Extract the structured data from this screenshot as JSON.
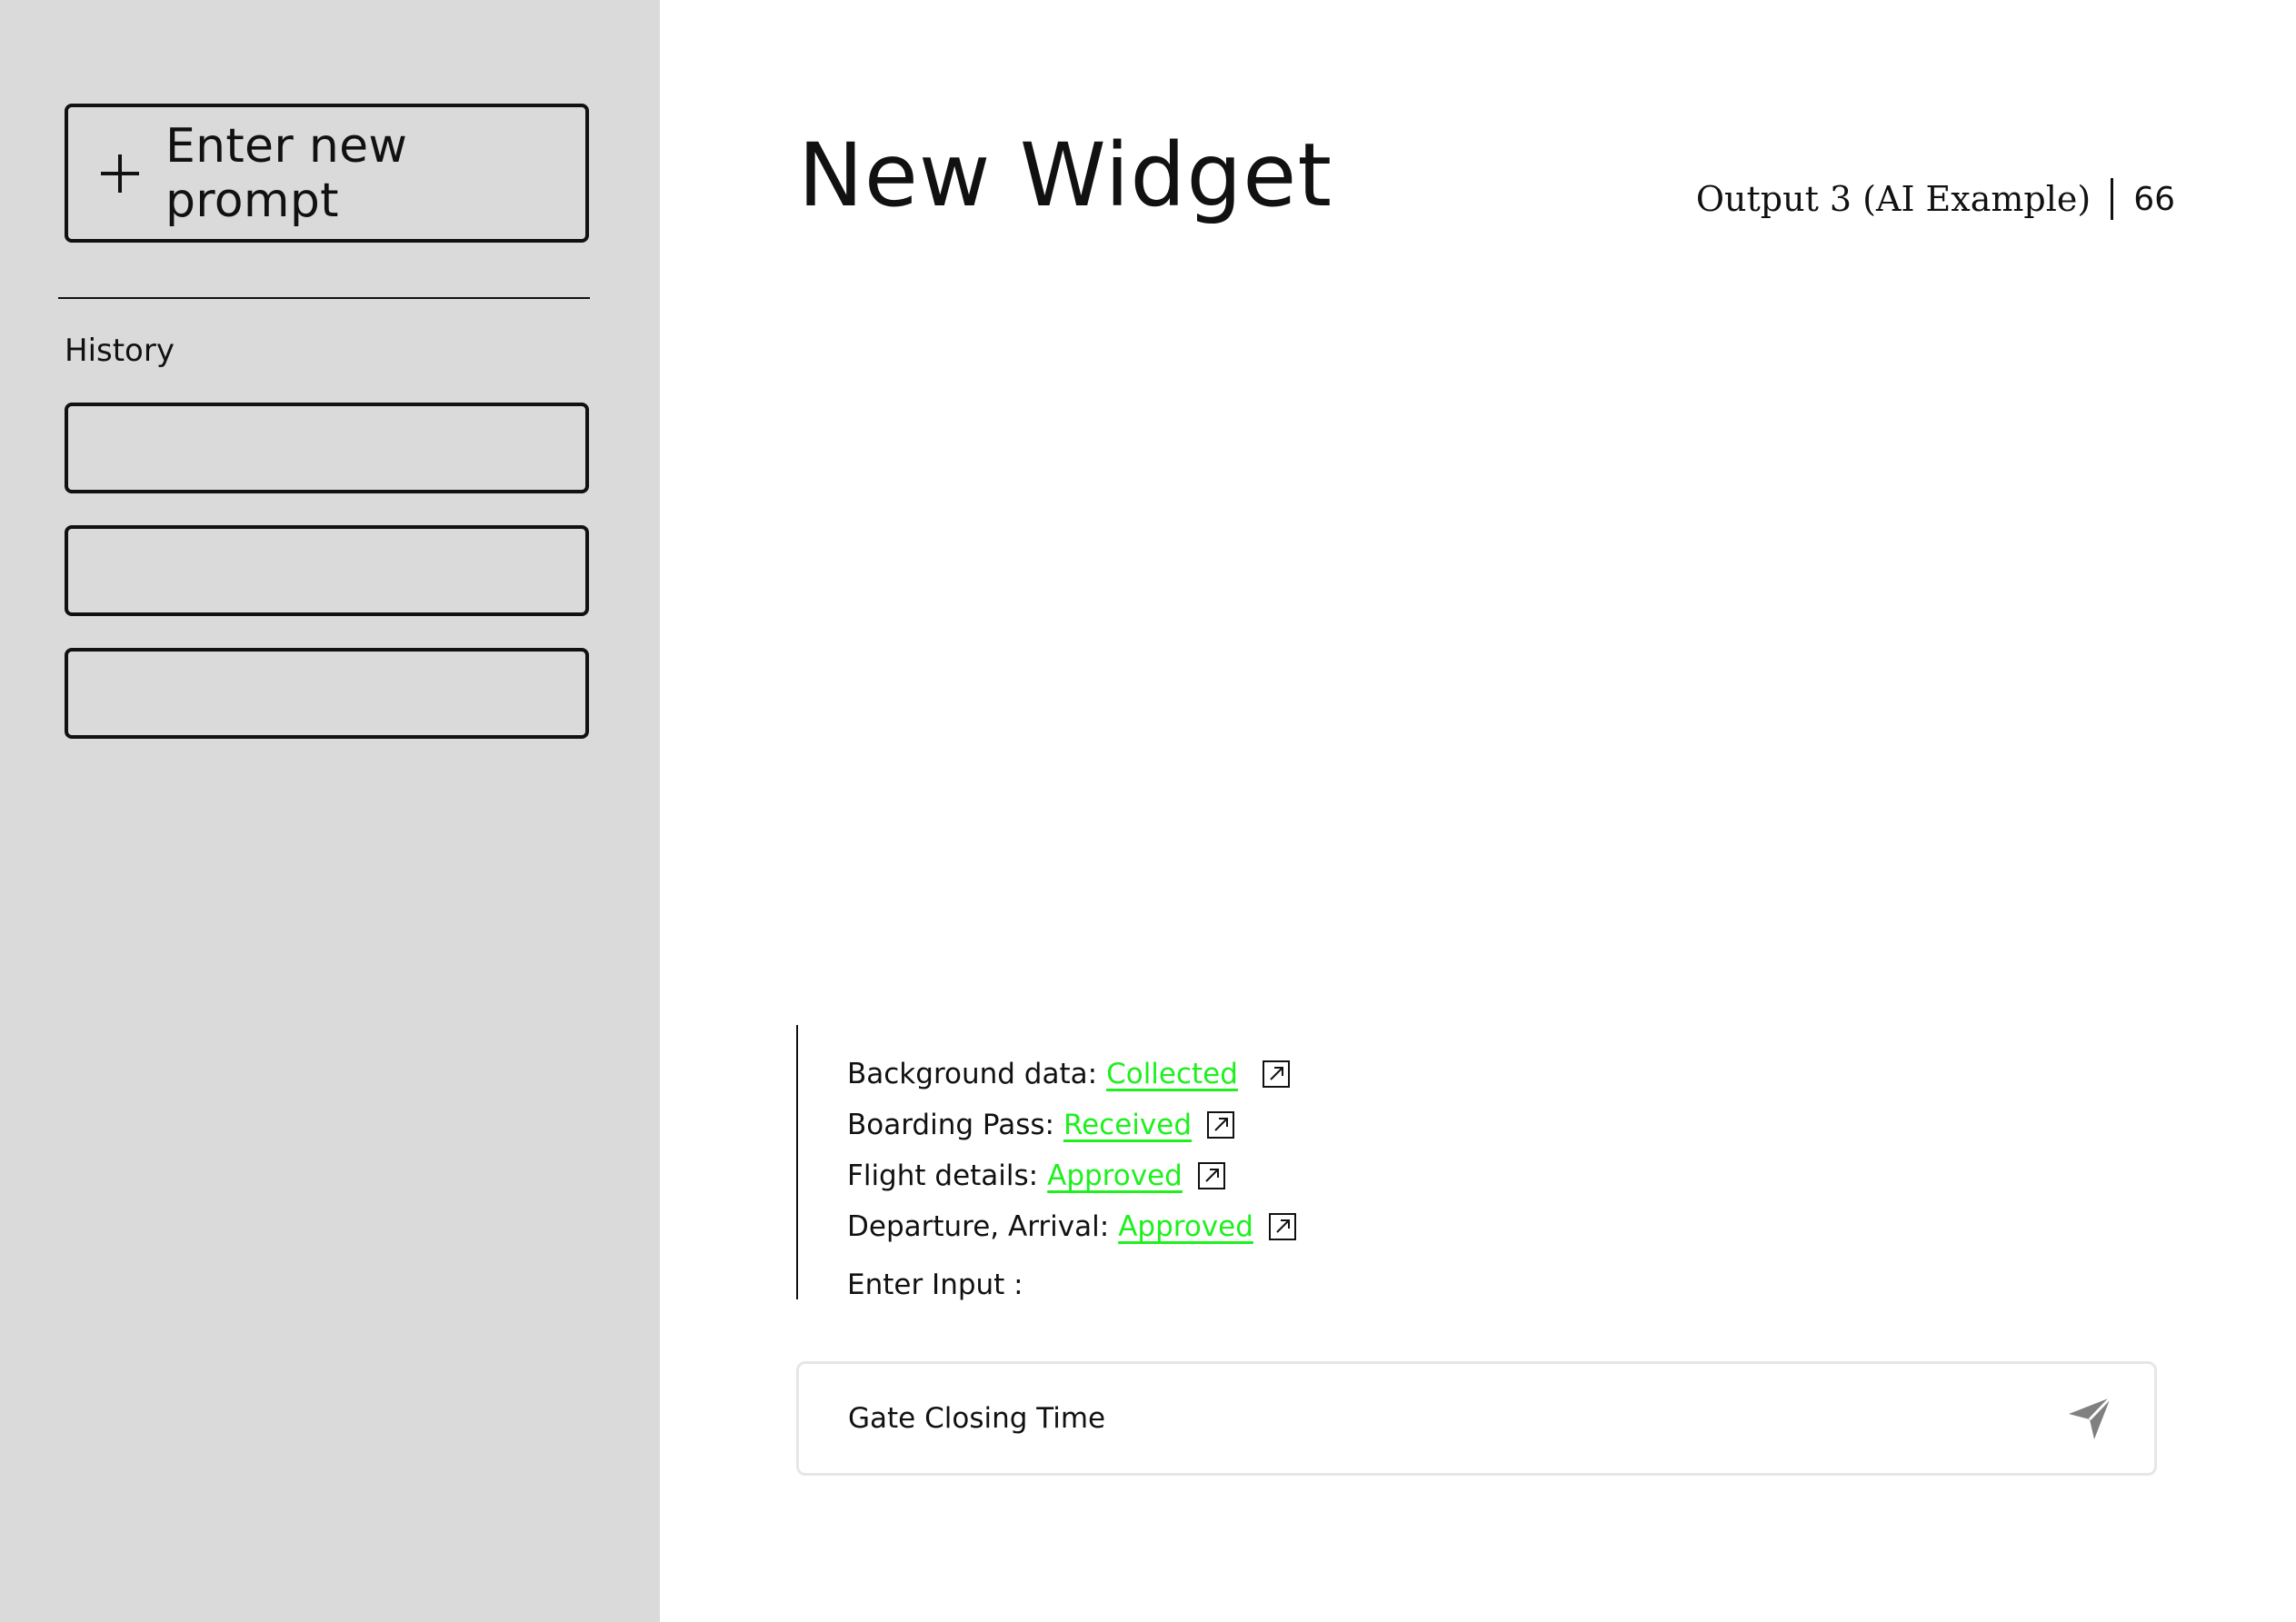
{
  "sidebar": {
    "new_prompt_label": "Enter new prompt",
    "history_label": "History",
    "history_items": [
      "",
      "",
      ""
    ]
  },
  "main": {
    "title": "New Widget",
    "output_label": "Output 3 (AI Example)",
    "output_count": "66"
  },
  "status": {
    "items": [
      {
        "label": "Background data:",
        "value": "Collected"
      },
      {
        "label": "Boarding Pass:",
        "value": "Received"
      },
      {
        "label": "Flight details:",
        "value": "Approved"
      },
      {
        "label": "Departure, Arrival:",
        "value": "Approved"
      }
    ],
    "enter_input_label": "Enter Input :",
    "status_color": "#1ef01e"
  },
  "input": {
    "value": "Gate Closing Time",
    "send_icon": "send-icon"
  }
}
